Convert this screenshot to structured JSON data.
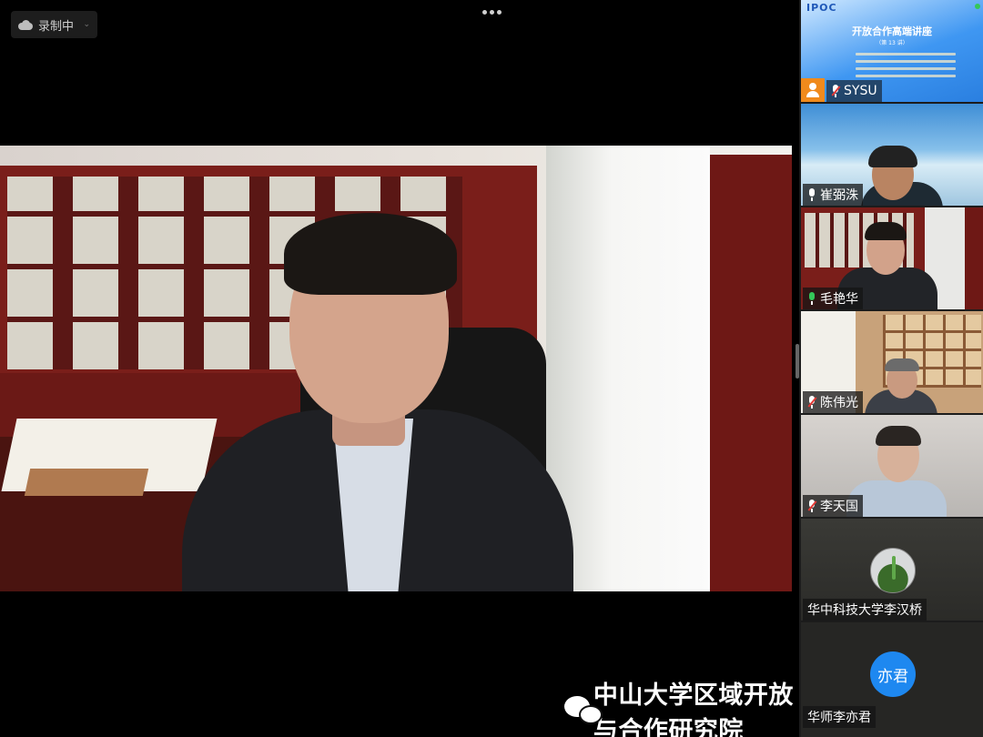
{
  "toolbar": {
    "recording_label": "录制中"
  },
  "main_speaker": {
    "name": "毛艳华"
  },
  "watermark": {
    "text": "中山大学区域开放与合作研究院"
  },
  "participants": [
    {
      "name": "SYSU",
      "type": "screen-share",
      "mic": "muted",
      "slide": {
        "logo": "IPOC",
        "title": "开放合作高端讲座",
        "subtitle": "（第 13 讲）"
      }
    },
    {
      "name": "崔弼洙",
      "mic": "on",
      "active": false
    },
    {
      "name": "毛艳华",
      "mic": "speaking",
      "active": true
    },
    {
      "name": "陈伟光",
      "mic": "muted",
      "active": false
    },
    {
      "name": "李天国",
      "mic": "muted",
      "active": false
    },
    {
      "name": "华中科技大学李汉桥",
      "mic": "none",
      "active": false
    },
    {
      "name": "华师李亦君",
      "mic": "none",
      "active": false,
      "avatar_text": "亦君"
    }
  ],
  "colors": {
    "active_border": "#34c759",
    "muted_icon": "#e53935",
    "badge_orange": "#f08a1c",
    "avatar_blue": "#1e88f0"
  }
}
